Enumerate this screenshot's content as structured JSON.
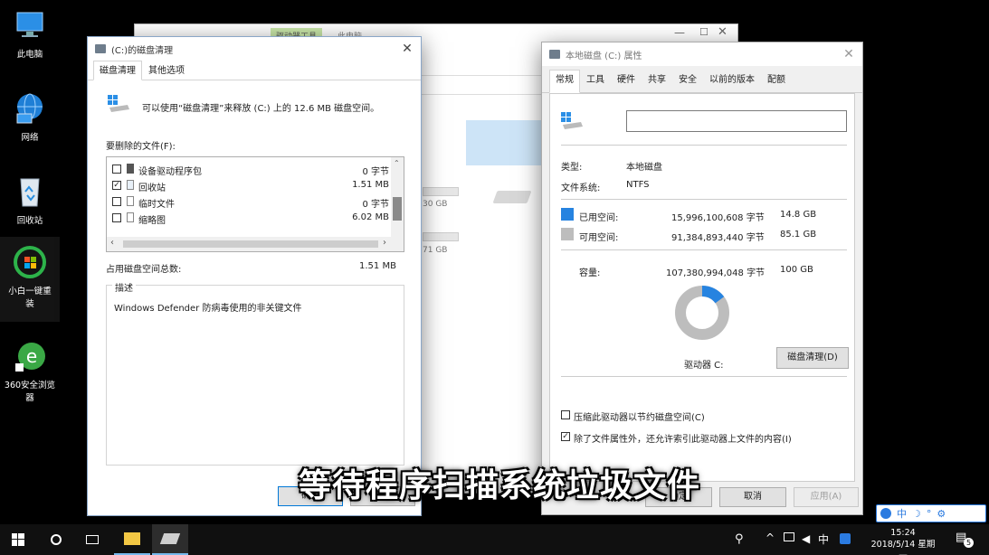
{
  "desktop": {
    "icons": [
      {
        "label": "此电脑"
      },
      {
        "label": "网络"
      },
      {
        "label": "回收站"
      },
      {
        "label": "小白一键重装"
      },
      {
        "label": "360安全浏览器"
      }
    ]
  },
  "explorer_bg": {
    "ribbon_tab_active": "驱动器工具",
    "ribbon_tab": "此电脑",
    "drive1_size": "30 GB",
    "drive2_size": "71 GB"
  },
  "cleanup": {
    "title": "(C:)的磁盘清理",
    "tabs": [
      "磁盘清理",
      "其他选项"
    ],
    "intro": "可以使用“磁盘清理”来释放  (C:) 上的 12.6 MB 磁盘空间。",
    "files_label": "要删除的文件(F):",
    "files": [
      {
        "name": "设备驱动程序包",
        "size": "0 字节",
        "checked": false
      },
      {
        "name": "回收站",
        "size": "1.51 MB",
        "checked": true
      },
      {
        "name": "临时文件",
        "size": "0 字节",
        "checked": false
      },
      {
        "name": "缩略图",
        "size": "6.02 MB",
        "checked": false
      }
    ],
    "total_label": "占用磁盘空间总数:",
    "total_value": "1.51 MB",
    "desc_label": "描述",
    "desc_text": "Windows Defender 防病毒使用的非关键文件",
    "ok": "确定",
    "cancel": "取消"
  },
  "props": {
    "title": "本地磁盘 (C:) 属性",
    "tabs": [
      "常规",
      "工具",
      "硬件",
      "共享",
      "安全",
      "以前的版本",
      "配额"
    ],
    "name_value": "",
    "type_label": "类型:",
    "type_value": "本地磁盘",
    "fs_label": "文件系统:",
    "fs_value": "NTFS",
    "used_label": "已用空间:",
    "used_bytes": "15,996,100,608 字节",
    "used_gb": "14.8 GB",
    "free_label": "可用空间:",
    "free_bytes": "91,384,893,440 字节",
    "free_gb": "85.1 GB",
    "cap_label": "容量:",
    "cap_bytes": "107,380,994,048 字节",
    "cap_gb": "100 GB",
    "drive_label": "驱动器 C:",
    "cleanup_btn": "磁盘清理(D)",
    "compress_label": "压缩此驱动器以节约磁盘空间(C)",
    "index_label": "除了文件属性外，还允许索引此驱动器上文件的内容(I)",
    "ok": "确定",
    "cancel": "取消",
    "apply": "应用(A)",
    "used_fraction": 0.149,
    "colors": {
      "used": "#2683e0",
      "free": "#bdbdbd"
    }
  },
  "subtitle": "等待程序扫描系统垃圾文件",
  "taskbar": {
    "ime": "中",
    "time": "15:24",
    "date": "2018/5/14 星期一",
    "notif_count": "5",
    "ime_bar": [
      "中",
      "☽",
      "°",
      "⚙"
    ]
  }
}
